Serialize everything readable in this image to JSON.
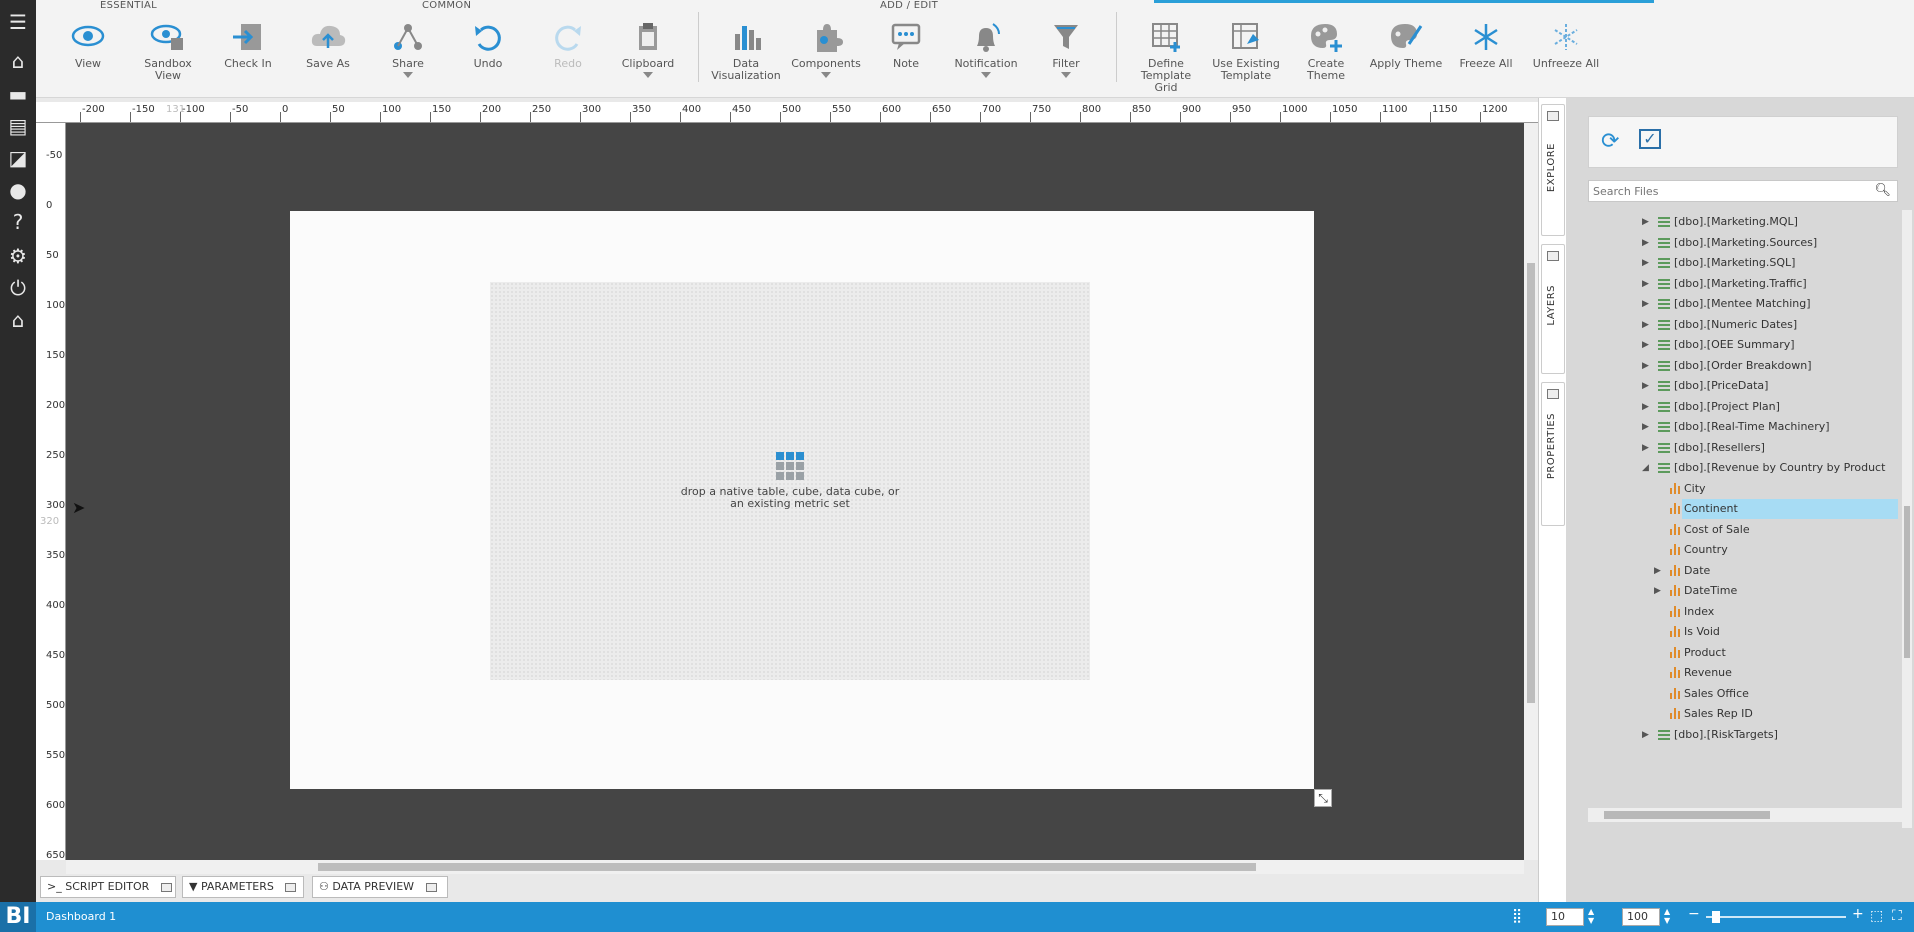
{
  "toolbar": {
    "groups": {
      "essential": "ESSENTIAL",
      "common": "COMMON",
      "add_edit": "ADD / EDIT"
    },
    "buttons": {
      "view": "View",
      "sandbox_view": "Sandbox View",
      "check_in": "Check In",
      "save_as": "Save As",
      "share": "Share",
      "undo": "Undo",
      "redo": "Redo",
      "clipboard": "Clipboard",
      "data_visualization": "Data Visualization",
      "components": "Components",
      "note": "Note",
      "notification": "Notification",
      "filter": "Filter",
      "define_template_grid": "Define Template Grid",
      "use_existing_template": "Use Existing Template",
      "create_theme": "Create Theme",
      "apply_theme": "Apply Theme",
      "freeze_all": "Freeze All",
      "unfreeze_all": "Unfreeze All"
    }
  },
  "canvas": {
    "unit": "px",
    "ruler_top": [
      "-200",
      "-150",
      "-100",
      "-50",
      "0",
      "50",
      "100",
      "150",
      "200",
      "250",
      "300",
      "350",
      "400",
      "450",
      "500",
      "550",
      "600",
      "650",
      "700",
      "750",
      "800",
      "850",
      "900",
      "950",
      "1000",
      "1050",
      "1100",
      "1150",
      "1200"
    ],
    "ruler_left": [
      "-50",
      "0",
      "50",
      "100",
      "150",
      "200",
      "250",
      "300",
      "350",
      "400",
      "450",
      "500",
      "550",
      "600",
      "650"
    ],
    "cursor_x_readout": "131",
    "cursor_y_readout": "320",
    "drop_message": "drop a native table, cube, data cube, or an existing metric set"
  },
  "side_tabs": {
    "explore": "EXPLORE",
    "layers": "LAYERS",
    "properties": "PROPERTIES"
  },
  "explore": {
    "search_placeholder": "Search Files",
    "tables": [
      "[dbo].[Marketing.MQL]",
      "[dbo].[Marketing.Sources]",
      "[dbo].[Marketing.SQL]",
      "[dbo].[Marketing.Traffic]",
      "[dbo].[Mentee Matching]",
      "[dbo].[Numeric Dates]",
      "[dbo].[OEE Summary]",
      "[dbo].[Order Breakdown]",
      "[dbo].[PriceData]",
      "[dbo].[Project Plan]",
      "[dbo].[Real-Time Machinery]",
      "[dbo].[Resellers]"
    ],
    "expanded_table": "[dbo].[Revenue by Country by Product",
    "fields": [
      "City",
      "Continent",
      "Cost of Sale",
      "Country",
      "Date",
      "DateTime",
      "Index",
      "Is Void",
      "Product",
      "Revenue",
      "Sales Office",
      "Sales Rep ID"
    ],
    "selected_field": "Continent",
    "last_table": "[dbo].[RiskTargets]"
  },
  "bottom_tabs": {
    "script_editor": "SCRIPT EDITOR",
    "parameters": "PARAMETERS",
    "data_preview": "DATA PREVIEW"
  },
  "status": {
    "logo": "BI",
    "dashboard_name": "Dashboard 1",
    "grid_size": "10",
    "zoom": "100"
  },
  "colors": {
    "accent": "#1f8fd1",
    "selection": "#a7dcf4",
    "canvas_bg": "#454545"
  }
}
